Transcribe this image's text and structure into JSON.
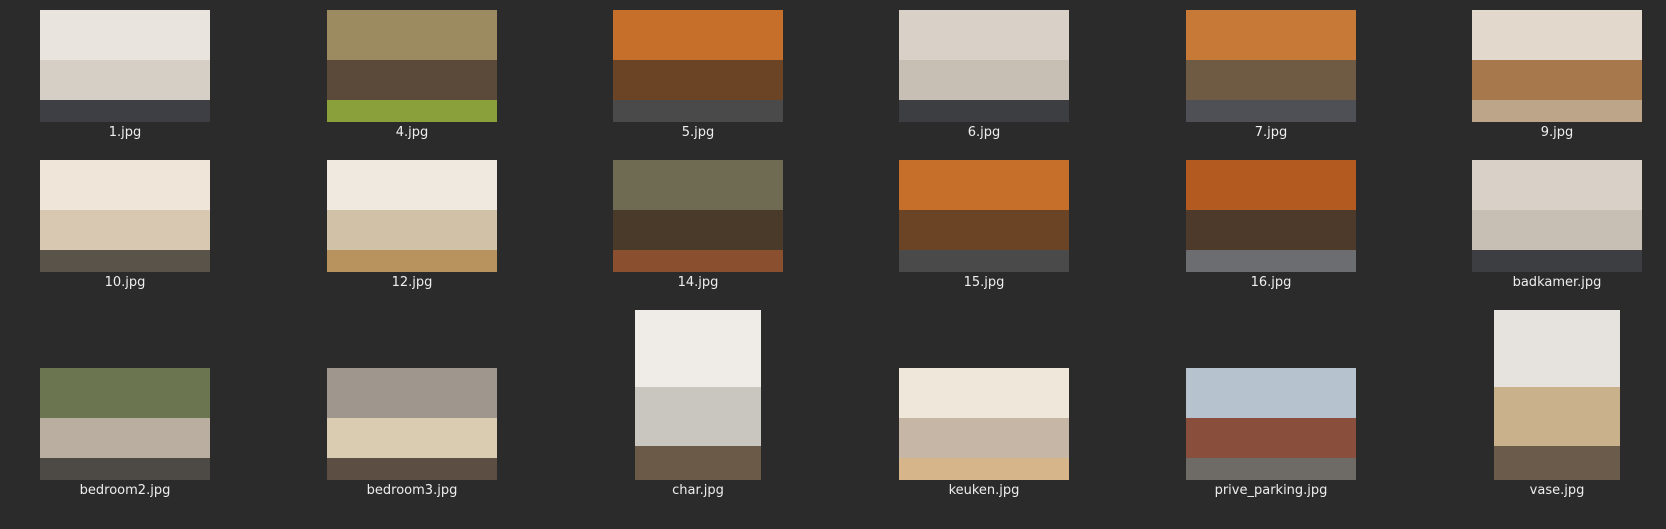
{
  "files": [
    {
      "name": "1.jpg",
      "kind": "landscape",
      "colors": [
        "#e9e4de",
        "#d6cfc6",
        "#3e3f44"
      ]
    },
    {
      "name": "4.jpg",
      "kind": "landscape",
      "colors": [
        "#9c8a61",
        "#5b4a3a",
        "#8aa03a"
      ]
    },
    {
      "name": "5.jpg",
      "kind": "landscape",
      "colors": [
        "#c66f2a",
        "#6b4325",
        "#4a4a4a"
      ]
    },
    {
      "name": "6.jpg",
      "kind": "landscape",
      "colors": [
        "#d9d1c8",
        "#c8bfb4",
        "#3d3e42"
      ]
    },
    {
      "name": "7.jpg",
      "kind": "landscape",
      "colors": [
        "#c77a38",
        "#6f5a44",
        "#4e5056"
      ]
    },
    {
      "name": "9.jpg",
      "kind": "landscape",
      "colors": [
        "#e2d8cb",
        "#a6784b",
        "#bda58a"
      ]
    },
    {
      "name": "10.jpg",
      "kind": "landscape",
      "colors": [
        "#efe6d9",
        "#d8c8b1",
        "#5a534a"
      ]
    },
    {
      "name": "12.jpg",
      "kind": "landscape",
      "colors": [
        "#efe9df",
        "#d1c2a7",
        "#b9935e"
      ]
    },
    {
      "name": "14.jpg",
      "kind": "landscape",
      "colors": [
        "#6f6a52",
        "#4a3a2a",
        "#8a4f2e"
      ]
    },
    {
      "name": "15.jpg",
      "kind": "landscape",
      "colors": [
        "#c66f2a",
        "#6b4325",
        "#4a4a4a"
      ]
    },
    {
      "name": "16.jpg",
      "kind": "landscape",
      "colors": [
        "#b35a20",
        "#4d3a2b",
        "#6b6d70"
      ]
    },
    {
      "name": "badkamer.jpg",
      "kind": "landscape",
      "colors": [
        "#d9d1c8",
        "#c8bfb4",
        "#3d3e42"
      ]
    },
    {
      "name": "bedroom2.jpg",
      "kind": "wide",
      "colors": [
        "#6b7650",
        "#b9aea0",
        "#4d4a46"
      ]
    },
    {
      "name": "bedroom3.jpg",
      "kind": "landscape",
      "colors": [
        "#9f978d",
        "#d9ccb1",
        "#5c4e43"
      ]
    },
    {
      "name": "char.jpg",
      "kind": "portrait",
      "colors": [
        "#efece7",
        "#c9c5bf",
        "#6b5a48"
      ]
    },
    {
      "name": "keuken.jpg",
      "kind": "wide",
      "colors": [
        "#f0e7db",
        "#c6b6a5",
        "#d7b58a"
      ]
    },
    {
      "name": "prive_parking.jpg",
      "kind": "wide",
      "colors": [
        "#b7c2cf",
        "#8a4f3c",
        "#6e6a66"
      ]
    },
    {
      "name": "vase.jpg",
      "kind": "tall",
      "colors": [
        "#e6e3de",
        "#c9b18c",
        "#6a5b4b"
      ]
    }
  ]
}
